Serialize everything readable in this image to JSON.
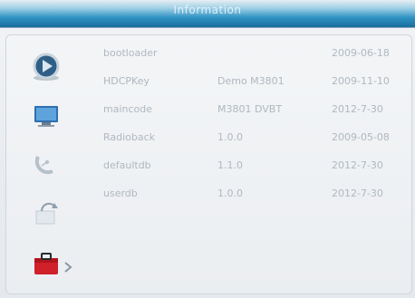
{
  "header": {
    "title": "Information"
  },
  "sidebar": {
    "items": [
      {
        "icon": "play-disc-icon"
      },
      {
        "icon": "monitor-icon"
      },
      {
        "icon": "satellite-dish-icon"
      },
      {
        "icon": "refresh-icon"
      },
      {
        "icon": "toolbox-icon",
        "selected": true
      }
    ]
  },
  "info_rows": [
    {
      "name": "bootloader",
      "version": "",
      "date": "2009-06-18"
    },
    {
      "name": "HDCPKey",
      "version": "Demo M3801",
      "date": "2009-11-10"
    },
    {
      "name": "maincode",
      "version": "M3801 DVBT",
      "date": "2012-7-30"
    },
    {
      "name": "Radioback",
      "version": "1.0.0",
      "date": "2009-05-08"
    },
    {
      "name": "defaultdb",
      "version": "1.1.0",
      "date": "2012-7-30"
    },
    {
      "name": "userdb",
      "version": "1.0.0",
      "date": "2012-7-30"
    }
  ],
  "colors": {
    "title_bar": "#2d92c2",
    "accent_red": "#d0202a",
    "text": "#b0b8c0"
  }
}
